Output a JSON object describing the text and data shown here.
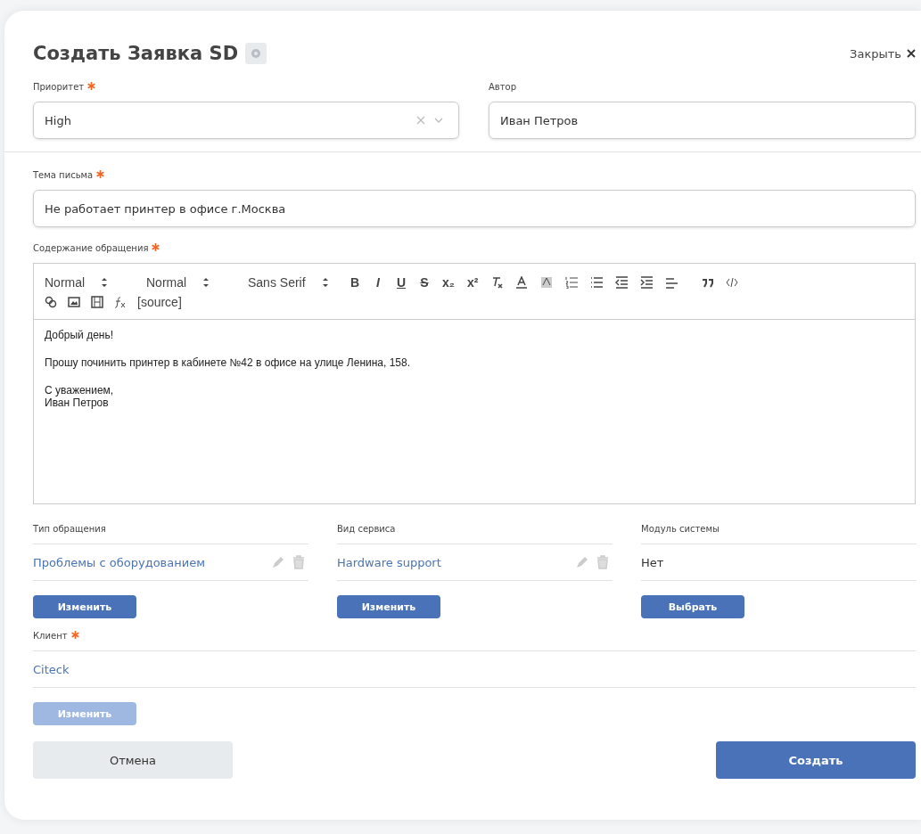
{
  "dialog": {
    "title": "Создать Заявка SD",
    "close_label": "Закрыть"
  },
  "priority": {
    "label": "Приоритет",
    "required": true,
    "value": "High"
  },
  "author": {
    "label": "Автор",
    "required": false,
    "value": "Иван Петров"
  },
  "subject": {
    "label": "Тема письма",
    "required": true,
    "value": "Не работает принтер в офисе г.Москва"
  },
  "content": {
    "label": "Содержание обращения",
    "required": true,
    "toolbar": {
      "selects": [
        "Normal",
        "Normal",
        "Sans Serif"
      ],
      "format_glyphs": [
        "B",
        "I",
        "U",
        "S",
        "x₂",
        "x²"
      ],
      "source": "[source]"
    },
    "paragraphs": [
      [
        "Добрый день!"
      ],
      [
        "Прошу починить принтер в кабинете №42 в офисе на улице Ленина, 158."
      ],
      [
        "С уважением,",
        "Иван Петров"
      ]
    ]
  },
  "pickers": [
    {
      "label": "Тип обращения",
      "value": "Проблемы с оборудованием",
      "linked": true,
      "editable": true,
      "button": "Изменить",
      "disabled": false
    },
    {
      "label": "Вид сервиса",
      "value": "Hardware support",
      "linked": true,
      "editable": true,
      "button": "Изменить",
      "disabled": false
    },
    {
      "label": "Модуль системы",
      "value": "Нет",
      "linked": false,
      "editable": false,
      "button": "Выбрать",
      "disabled": false
    }
  ],
  "client": {
    "label": "Клиент",
    "required": true,
    "value": "Citeck",
    "button": "Изменить",
    "disabled": true
  },
  "buttons": {
    "cancel": "Отмена",
    "submit": "Создать"
  }
}
